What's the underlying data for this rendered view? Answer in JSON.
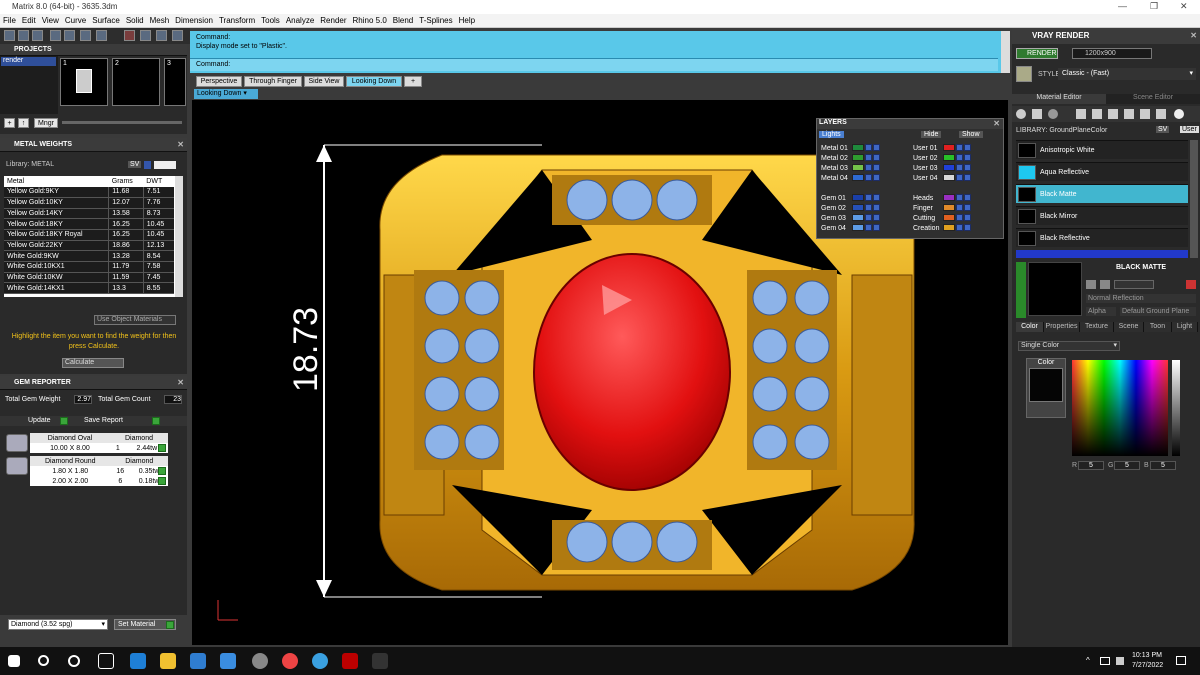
{
  "title": "Matrix 8.0 (64-bit) - 3635.3dm",
  "window_controls": [
    "—",
    "❐",
    "✕"
  ],
  "menu": [
    "File",
    "Edit",
    "View",
    "Curve",
    "Surface",
    "Solid",
    "Mesh",
    "Dimension",
    "Transform",
    "Tools",
    "Analyze",
    "Render",
    "Rhino 5.0",
    "Blend",
    "T-Splines",
    "Help"
  ],
  "projects": {
    "title": "PROJECTS",
    "item": "render",
    "thumbs": [
      "1",
      "2",
      "3"
    ],
    "mngr": "Mngr"
  },
  "metal_weights": {
    "title": "METAL WEIGHTS",
    "library": "Library: METAL",
    "sv": "SV",
    "cols": [
      "Metal",
      "Grams",
      "DWT"
    ],
    "rows": [
      [
        "Yellow Gold:9KY",
        "11.68",
        "7.51"
      ],
      [
        "Yellow Gold:10KY",
        "12.07",
        "7.76"
      ],
      [
        "Yellow Gold:14KY",
        "13.58",
        "8.73"
      ],
      [
        "Yellow Gold:18KY",
        "16.25",
        "10.45"
      ],
      [
        "Yellow Gold:18KY Royal",
        "16.25",
        "10.45"
      ],
      [
        "Yellow Gold:22KY",
        "18.86",
        "12.13"
      ],
      [
        "White Gold:9KW",
        "13.28",
        "8.54"
      ],
      [
        "White Gold:10KX1",
        "11.79",
        "7.58"
      ],
      [
        "White Gold:10KW",
        "11.59",
        "7.45"
      ],
      [
        "White Gold:14KX1",
        "13.3",
        "8.55"
      ]
    ],
    "use_object_materials": "Use Object Materials",
    "hint": "Highlight the item you want to find the weight for then press Calculate.",
    "calculate": "Calculate"
  },
  "gem_reporter": {
    "title": "GEM REPORTER",
    "total_weight_label": "Total Gem Weight",
    "total_weight": "2.97",
    "total_count_label": "Total Gem Count",
    "total_count": "23",
    "update": "Update",
    "save_report": "Save Report",
    "groups": [
      {
        "shape": "Diamond Oval",
        "material": "Diamond",
        "rows": [
          [
            "10.00 X 8.00",
            "1",
            "2.44tw"
          ]
        ]
      },
      {
        "shape": "Diamond Round",
        "material": "Diamond",
        "rows": [
          [
            "1.80 X 1.80",
            "16",
            "0.35tw"
          ],
          [
            "2.00 X 2.00",
            "6",
            "0.18tw"
          ]
        ]
      }
    ],
    "select": "Diamond     (3.52 spg)",
    "set_material": "Set Material"
  },
  "command": {
    "line1": "Command:",
    "line2": "Display mode set to \"Plastic\".",
    "prompt": "Command:"
  },
  "viewport_tabs": [
    "Perspective",
    "Through Finger",
    "Side View",
    "Looking Down",
    "+"
  ],
  "viewport_label": "Looking Down",
  "dimension": "18.73",
  "layers": {
    "title": "LAYERS",
    "lights": "Lights",
    "hide": "Hide",
    "show": "Show",
    "left": [
      {
        "name": "Metal 01",
        "color": "#1f8a3c"
      },
      {
        "name": "Metal 02",
        "color": "#2f9c2f"
      },
      {
        "name": "Metal 03",
        "color": "#74c34a"
      },
      {
        "name": "Metal 04",
        "color": "#2e6ad1"
      },
      {
        "name": "Gem 01",
        "color": "#1a3fa8"
      },
      {
        "name": "Gem 02",
        "color": "#2651b8"
      },
      {
        "name": "Gem 03",
        "color": "#5e9ce5"
      },
      {
        "name": "Gem 04",
        "color": "#5e9ce5"
      }
    ],
    "right": [
      {
        "name": "User 01",
        "color": "#e02020"
      },
      {
        "name": "User 02",
        "color": "#28c028"
      },
      {
        "name": "User 03",
        "color": "#2040d8"
      },
      {
        "name": "User 04",
        "color": "#d8d8d8"
      },
      {
        "name": "Heads",
        "color": "#9a2fc2"
      },
      {
        "name": "Finger",
        "color": "#e08a2a"
      },
      {
        "name": "Cutting",
        "color": "#e06020"
      },
      {
        "name": "Creation",
        "color": "#e0a020"
      }
    ]
  },
  "vray": {
    "title": "VRAY RENDER",
    "render": "RENDER",
    "res": "1200x900",
    "style_label": "STYLE:",
    "style": "Classic - (Fast)",
    "tabs": [
      "Material Editor",
      "Scene Editor"
    ],
    "library": "LIBRARY: GroundPlaneColor",
    "sv": "SV",
    "user": "User",
    "materials": [
      "Anisotropic White",
      "Aqua Reflective",
      "Black Matte",
      "Black Mirror",
      "Black Reflective"
    ],
    "selected": "BLACK MATTE",
    "normal": "Normal Reflection",
    "alpha": "Alpha",
    "default_ground": "Default Ground Plane",
    "subtabs": [
      "Color",
      "Properties",
      "Texture",
      "Scene",
      "Toon",
      "Light"
    ],
    "single_color": "Single Color",
    "color_label": "Color",
    "rgb": [
      {
        "k": "R",
        "v": "5"
      },
      {
        "k": "G",
        "v": "5"
      },
      {
        "k": "B",
        "v": "5"
      }
    ]
  },
  "taskbar": {
    "time": "10:13 PM",
    "date": "7/27/2022"
  }
}
